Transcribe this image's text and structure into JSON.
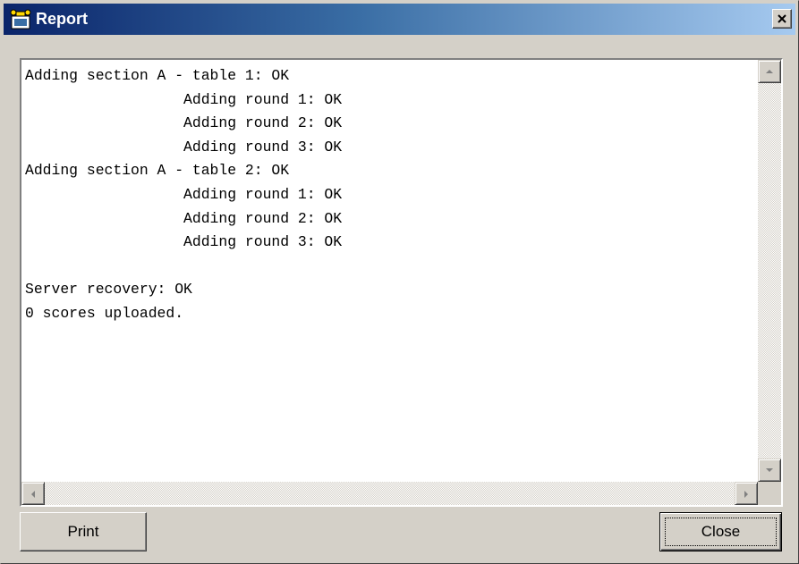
{
  "window": {
    "title": "Report",
    "icon": "report-app-icon",
    "close_glyph": "close-icon"
  },
  "report": {
    "lines": [
      "Adding section A - table 1: OK",
      "                  Adding round 1: OK",
      "                  Adding round 2: OK",
      "                  Adding round 3: OK",
      "Adding section A - table 2: OK",
      "                  Adding round 1: OK",
      "                  Adding round 2: OK",
      "                  Adding round 3: OK",
      "",
      "Server recovery: OK",
      "0 scores uploaded."
    ]
  },
  "buttons": {
    "print_label": "Print",
    "close_label": "Close"
  },
  "colors": {
    "titlebar_start": "#0a246a",
    "titlebar_end": "#a6caf0",
    "face": "#d4d0c8"
  }
}
